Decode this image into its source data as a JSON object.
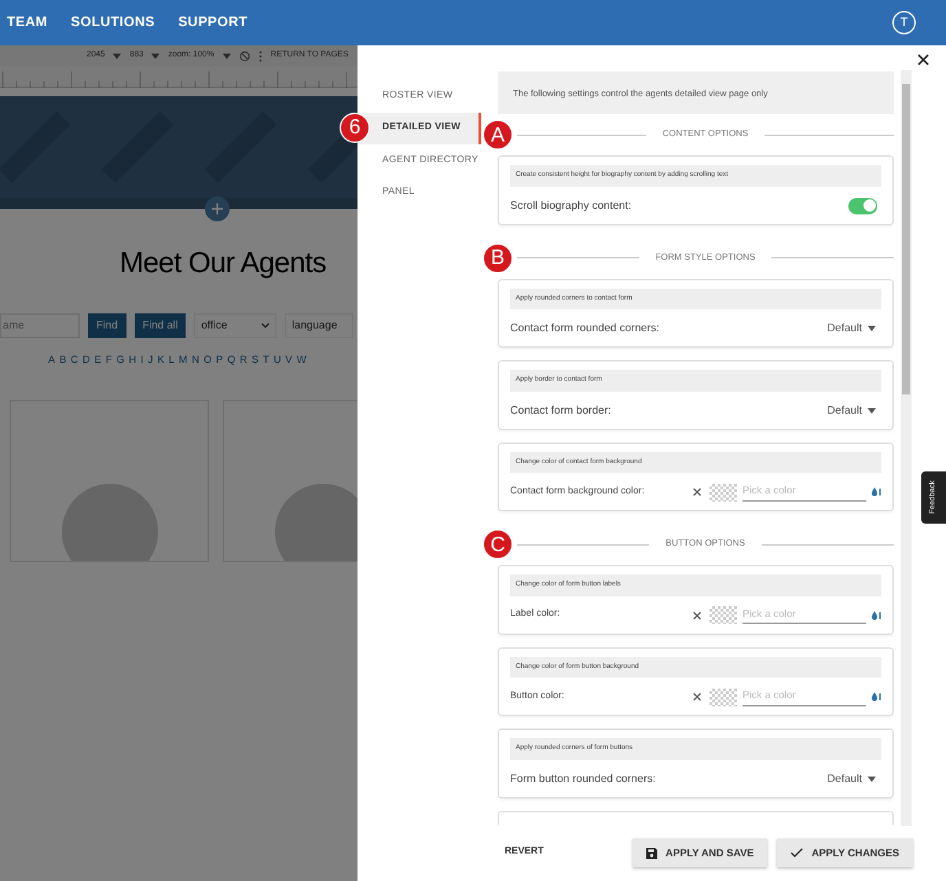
{
  "top_nav": {
    "items": [
      "TEAM",
      "SOLUTIONS",
      "SUPPORT"
    ],
    "avatar": "T"
  },
  "editor_toolbar": {
    "items": [
      "2045",
      "883",
      "zoom: 100%"
    ],
    "return_link": "RETURN TO PAGES"
  },
  "background_page": {
    "title": "Meet Our Agents",
    "search": {
      "placeholder": "ame",
      "buttons": [
        "Find",
        "Find all"
      ],
      "selects": [
        "office",
        "language"
      ]
    },
    "letters": [
      "A",
      "B",
      "C",
      "D",
      "E",
      "F",
      "G",
      "H",
      "I",
      "J",
      "K",
      "L",
      "M",
      "N",
      "O",
      "P",
      "Q",
      "R",
      "S",
      "T",
      "U",
      "V",
      "W"
    ]
  },
  "settings_panel": {
    "tabs": [
      {
        "label": "ROSTER VIEW",
        "selected": false
      },
      {
        "label": "DETAILED VIEW",
        "selected": true,
        "callout": "6"
      },
      {
        "label": "AGENT DIRECTORY",
        "selected": false
      },
      {
        "label": "PANEL",
        "selected": false
      }
    ],
    "intro": "The following settings control the agents detailed view page only",
    "sections": [
      {
        "heading": "CONTENT OPTIONS",
        "callout": "A",
        "settings": [
          {
            "kind": "toggle",
            "hint": "Create consistent height for biography content by adding scrolling text",
            "label": "Scroll biography content:",
            "on": true
          }
        ]
      },
      {
        "heading": "FORM STYLE OPTIONS",
        "callout": "B",
        "settings": [
          {
            "kind": "select",
            "hint": "Apply rounded corners to contact form",
            "label": "Contact form rounded corners:",
            "value": "Default"
          },
          {
            "kind": "select",
            "hint": "Apply border to contact form",
            "label": "Contact form border:",
            "value": "Default"
          },
          {
            "kind": "color",
            "hint": "Change color of contact form background",
            "label": "Contact form background color:",
            "placeholder": "Pick a color"
          }
        ]
      },
      {
        "heading": "BUTTON OPTIONS",
        "callout": "C",
        "settings": [
          {
            "kind": "color",
            "hint": "Change color of form button labels",
            "label": "Label color:",
            "placeholder": "Pick a color"
          },
          {
            "kind": "color",
            "hint": "Change color of form button background",
            "label": "Button color:",
            "placeholder": "Pick a color"
          },
          {
            "kind": "select",
            "hint": "Apply rounded corners of form buttons",
            "label": "Form button rounded corners:",
            "value": "Default"
          }
        ]
      }
    ],
    "footer": {
      "revert": "REVERT",
      "apply_save": "APPLY AND SAVE",
      "apply": "APPLY CHANGES"
    }
  },
  "feedback_tab": "Feedback"
}
